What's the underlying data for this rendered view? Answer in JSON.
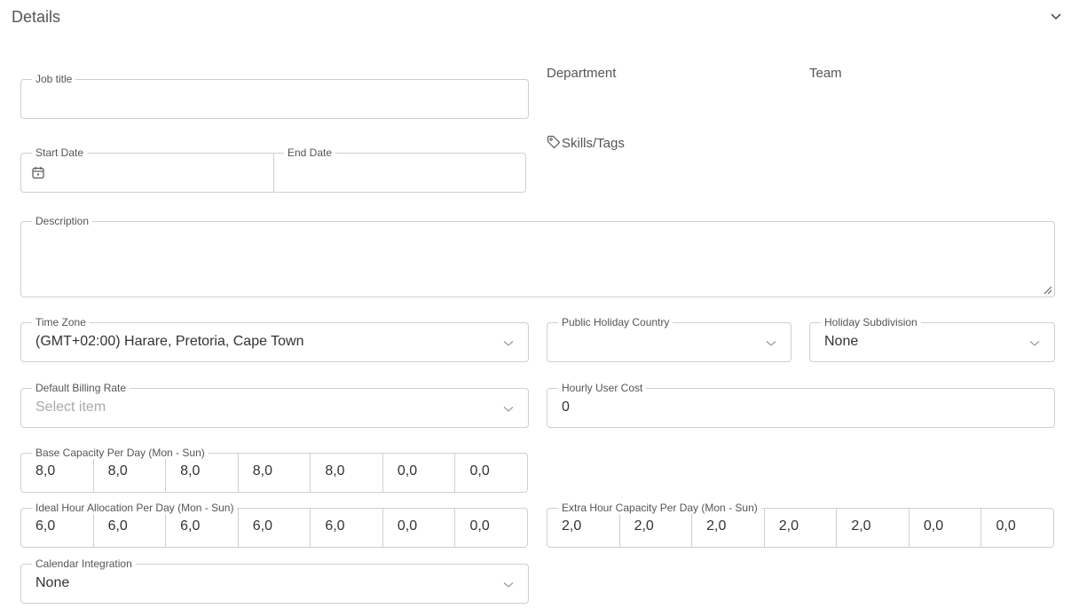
{
  "section": {
    "title": "Details"
  },
  "fields": {
    "job_title": {
      "label": "Job title",
      "value": ""
    },
    "department": {
      "label": "Department"
    },
    "team": {
      "label": "Team"
    },
    "start_date": {
      "label": "Start Date",
      "value": ""
    },
    "end_date": {
      "label": "End Date",
      "value": ""
    },
    "skills": {
      "label": "Skills/Tags",
      "icon": "tag-icon"
    },
    "description": {
      "label": "Description",
      "value": ""
    },
    "time_zone": {
      "label": "Time Zone",
      "value": "(GMT+02:00) Harare, Pretoria, Cape Town"
    },
    "holiday_country": {
      "label": "Public Holiday Country",
      "value": ""
    },
    "holiday_subdivision": {
      "label": "Holiday Subdivision",
      "value": "None"
    },
    "billing_rate": {
      "label": "Default Billing Rate",
      "placeholder": "Select item"
    },
    "hourly_cost": {
      "label": "Hourly User Cost",
      "value": "0"
    },
    "base_capacity": {
      "label": "Base Capacity Per Day (Mon - Sun)",
      "values": [
        "8,0",
        "8,0",
        "8,0",
        "8,0",
        "8,0",
        "0,0",
        "0,0"
      ]
    },
    "ideal_allocation": {
      "label": "Ideal Hour Allocation Per Day (Mon - Sun)",
      "values": [
        "6,0",
        "6,0",
        "6,0",
        "6,0",
        "6,0",
        "0,0",
        "0,0"
      ]
    },
    "extra_capacity": {
      "label": "Extra Hour Capacity Per Day (Mon - Sun)",
      "values": [
        "2,0",
        "2,0",
        "2,0",
        "2,0",
        "2,0",
        "0,0",
        "0,0"
      ]
    },
    "calendar_integration": {
      "label": "Calendar Integration",
      "value": "None"
    }
  },
  "colors": {
    "border": "#cfcfcf",
    "label": "#555555",
    "placeholder": "#a9a9a9"
  }
}
